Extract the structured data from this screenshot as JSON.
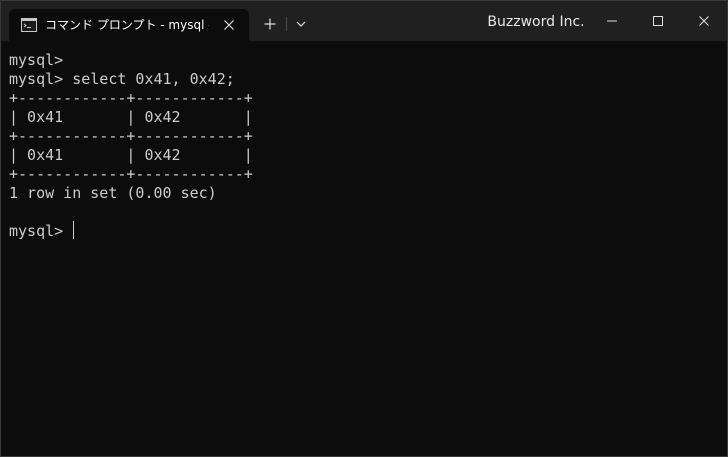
{
  "window": {
    "tab_title": "コマンド プロンプト - mysql  -u root",
    "brand": "Buzzword Inc.",
    "new_tab_symbol": "+",
    "dropdown_symbol": "⌄",
    "icons": {
      "tab": "cmd-icon",
      "close_tab": "close-icon",
      "new_tab": "plus-icon",
      "dropdown": "chevron-down-icon",
      "minimize": "minimize-icon",
      "maximize": "maximize-icon",
      "close_window": "close-icon"
    }
  },
  "colors": {
    "titlebar": "#202020",
    "console_bg": "#0c0c0c",
    "console_text": "#cccccc"
  },
  "terminal": {
    "lines": [
      "mysql>",
      "mysql> select 0x41, 0x42;",
      "+------------+------------+",
      "| 0x41       | 0x42       |",
      "+------------+------------+",
      "| 0x41       | 0x42       |",
      "+------------+------------+",
      "1 row in set (0.00 sec)",
      "",
      "mysql>"
    ]
  }
}
